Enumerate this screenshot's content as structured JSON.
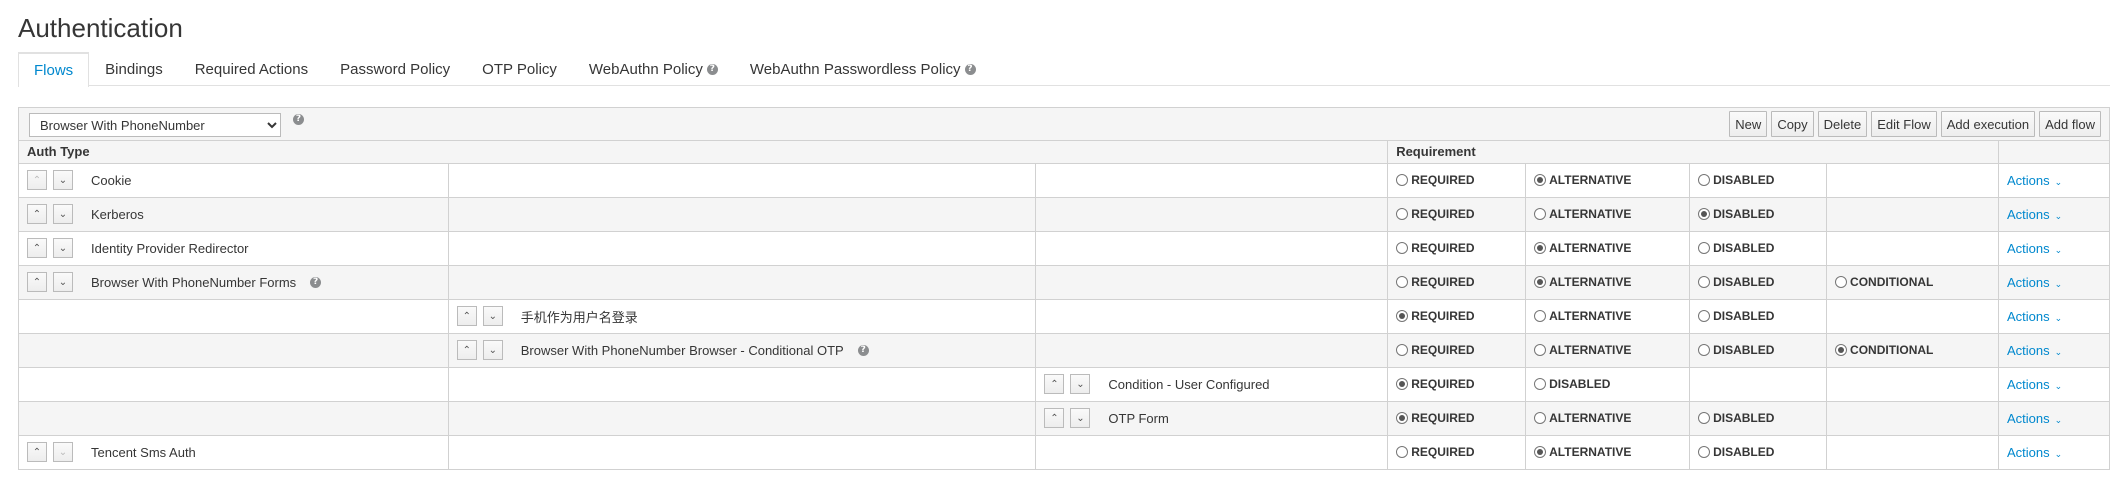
{
  "page": {
    "title": "Authentication"
  },
  "tabs": [
    {
      "label": "Flows",
      "active": true,
      "help": false
    },
    {
      "label": "Bindings",
      "active": false,
      "help": false
    },
    {
      "label": "Required Actions",
      "active": false,
      "help": false
    },
    {
      "label": "Password Policy",
      "active": false,
      "help": false
    },
    {
      "label": "OTP Policy",
      "active": false,
      "help": false
    },
    {
      "label": "WebAuthn Policy",
      "active": false,
      "help": true
    },
    {
      "label": "WebAuthn Passwordless Policy",
      "active": false,
      "help": true
    }
  ],
  "toolbar": {
    "selected_flow": "Browser With PhoneNumber",
    "buttons": {
      "new": "New",
      "copy": "Copy",
      "delete": "Delete",
      "edit_flow": "Edit Flow",
      "add_execution": "Add execution",
      "add_flow": "Add flow"
    }
  },
  "table": {
    "headers": {
      "auth_type": "Auth Type",
      "requirement": "Requirement"
    },
    "actions_label": "Actions",
    "rows": [
      {
        "name": "Cookie",
        "level": 0,
        "help": false,
        "up_enabled": false,
        "down_enabled": true,
        "options": [
          "REQUIRED",
          "ALTERNATIVE",
          "DISABLED",
          ""
        ],
        "selected": "ALTERNATIVE"
      },
      {
        "name": "Kerberos",
        "level": 0,
        "help": false,
        "up_enabled": true,
        "down_enabled": true,
        "options": [
          "REQUIRED",
          "ALTERNATIVE",
          "DISABLED",
          ""
        ],
        "selected": "DISABLED"
      },
      {
        "name": "Identity Provider Redirector",
        "level": 0,
        "help": false,
        "up_enabled": true,
        "down_enabled": true,
        "options": [
          "REQUIRED",
          "ALTERNATIVE",
          "DISABLED",
          ""
        ],
        "selected": "ALTERNATIVE"
      },
      {
        "name": "Browser With PhoneNumber Forms",
        "level": 0,
        "help": true,
        "up_enabled": true,
        "down_enabled": true,
        "options": [
          "REQUIRED",
          "ALTERNATIVE",
          "DISABLED",
          "CONDITIONAL"
        ],
        "selected": "ALTERNATIVE"
      },
      {
        "name": "手机作为用户名登录",
        "level": 1,
        "help": false,
        "up_enabled": true,
        "down_enabled": true,
        "options": [
          "REQUIRED",
          "ALTERNATIVE",
          "DISABLED",
          ""
        ],
        "selected": "REQUIRED"
      },
      {
        "name": "Browser With PhoneNumber Browser - Conditional OTP",
        "level": 1,
        "help": true,
        "up_enabled": true,
        "down_enabled": true,
        "options": [
          "REQUIRED",
          "ALTERNATIVE",
          "DISABLED",
          "CONDITIONAL"
        ],
        "selected": "CONDITIONAL"
      },
      {
        "name": "Condition - User Configured",
        "level": 2,
        "help": false,
        "up_enabled": true,
        "down_enabled": true,
        "options": [
          "REQUIRED",
          "DISABLED",
          "",
          ""
        ],
        "selected": "REQUIRED"
      },
      {
        "name": "OTP Form",
        "level": 2,
        "help": false,
        "up_enabled": true,
        "down_enabled": true,
        "options": [
          "REQUIRED",
          "ALTERNATIVE",
          "DISABLED",
          ""
        ],
        "selected": "REQUIRED"
      },
      {
        "name": "Tencent Sms Auth",
        "level": 0,
        "help": false,
        "up_enabled": true,
        "down_enabled": false,
        "options": [
          "REQUIRED",
          "ALTERNATIVE",
          "DISABLED",
          ""
        ],
        "selected": "ALTERNATIVE"
      }
    ]
  },
  "colors": {
    "link": "#0088ce",
    "border": "#d1d1d1",
    "stripe": "#f5f5f5"
  },
  "icons": {
    "help": "question-circle-icon",
    "up": "chevron-up-icon",
    "down": "chevron-down-icon",
    "caret": "caret-down-icon"
  }
}
